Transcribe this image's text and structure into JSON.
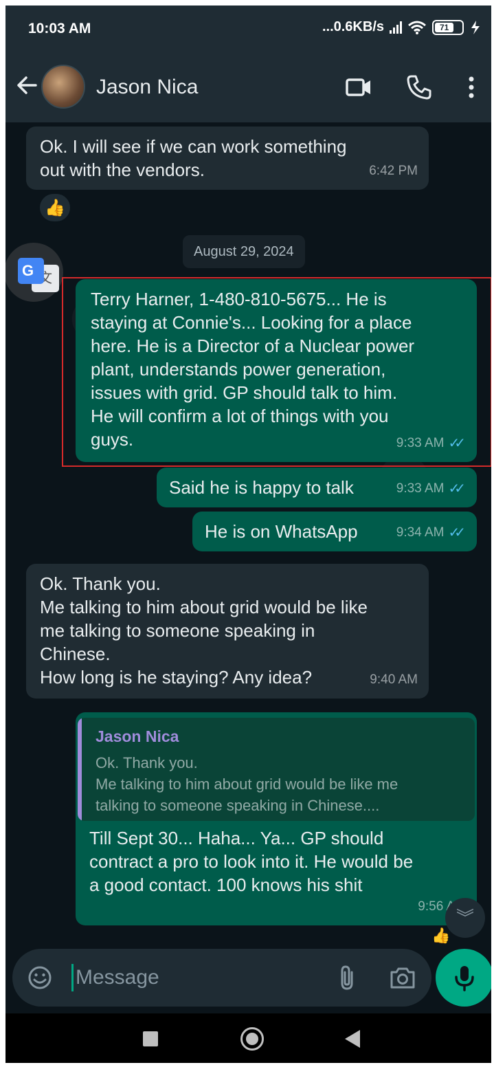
{
  "status_bar": {
    "time": "10:03 AM",
    "network_speed": "...0.6KB/s",
    "battery_level": "71"
  },
  "header": {
    "contact_name": "Jason Nica",
    "icons": [
      "back-arrow-icon",
      "video-call-icon",
      "voice-call-icon",
      "more-options-icon"
    ]
  },
  "messages": [
    {
      "direction": "incoming",
      "text": "Ok. I will see if we can work something\nout with the vendors.",
      "time": "6:42 PM",
      "reaction": "👍"
    },
    {
      "type": "date_separator",
      "text": "August 29, 2024"
    },
    {
      "direction": "outgoing",
      "text": "Terry Harner, 1-480-810-5675... He is\nstaying at Connie's... Looking for a place\nhere. He is a Director of a Nuclear power\nplant, understands power generation,\nissues with grid. GP should talk to him.\nHe will confirm a lot of things with you\nguys.",
      "time": "9:33 AM",
      "status": "read",
      "highlighted": true
    },
    {
      "direction": "outgoing",
      "text": "Said he is happy to talk",
      "time": "9:33 AM",
      "status": "read"
    },
    {
      "direction": "outgoing",
      "text": "He is on WhatsApp",
      "time": "9:34 AM",
      "status": "read"
    },
    {
      "direction": "incoming",
      "text": "Ok. Thank you.\nMe talking to him about grid would be like\nme talking to someone speaking in\nChinese.\nHow long is he staying? Any idea?",
      "time": "9:40 AM"
    },
    {
      "direction": "outgoing",
      "quoted": {
        "author": "Jason Nica",
        "text": "Ok. Thank you.\nMe talking to him about grid would be like me\ntalking to someone speaking in Chinese...."
      },
      "text": "Till Sept 30... Haha... Ya... GP should\ncontract a pro to look into it. He would be\na good contact. 100 knows his shit",
      "time": "9:56 AM"
    }
  ],
  "composer": {
    "placeholder": "Message"
  },
  "colors": {
    "background": "#0b141a",
    "incoming_bubble": "#202c33",
    "outgoing_bubble": "#005c4b",
    "accent": "#00a884",
    "read_ticks": "#53bdeb",
    "highlight_box": "#d42a2a",
    "quote_author": "#a08cdb"
  }
}
